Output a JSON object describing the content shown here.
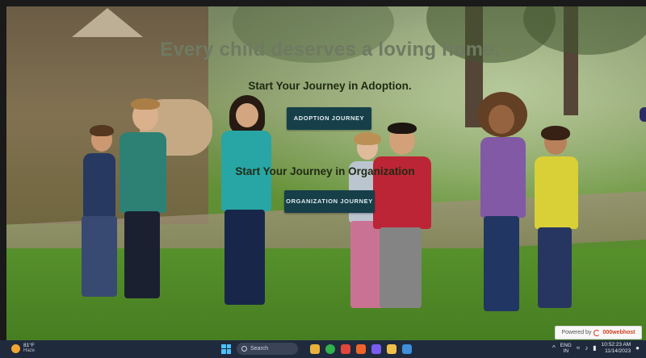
{
  "hero": {
    "headline": "Every child deserves a loving home.",
    "adoption_subtitle": "Start Your Journey in Adoption.",
    "adoption_button": "ADOPTION JOURNEY",
    "organization_subtitle": "Start Your Journey in Organization",
    "organization_button": "ORGANIZATION JOURNEY",
    "button_color": "#163f4a"
  },
  "powered_badge": {
    "prefix": "Powered by",
    "brand": "000webhost"
  },
  "taskbar": {
    "weather": {
      "temperature": "81°F",
      "condition": "Haze",
      "icon": "sun-icon"
    },
    "search_label": "Search",
    "apps": [
      {
        "name": "file-explorer-icon",
        "color": "#e9b23a"
      },
      {
        "name": "whatsapp-icon",
        "color": "#2fb34a"
      },
      {
        "name": "browser-icon",
        "color": "#e0463a"
      },
      {
        "name": "brave-icon",
        "color": "#f0642a"
      },
      {
        "name": "app-icon-purple",
        "color": "#7a5cf0"
      },
      {
        "name": "folder-icon",
        "color": "#f1c04a"
      },
      {
        "name": "photos-icon",
        "color": "#3f8fd9"
      }
    ],
    "tray": {
      "language_top": "ENG",
      "language_bottom": "IN",
      "time": "10:52:23 AM",
      "date": "11/14/2023"
    }
  }
}
